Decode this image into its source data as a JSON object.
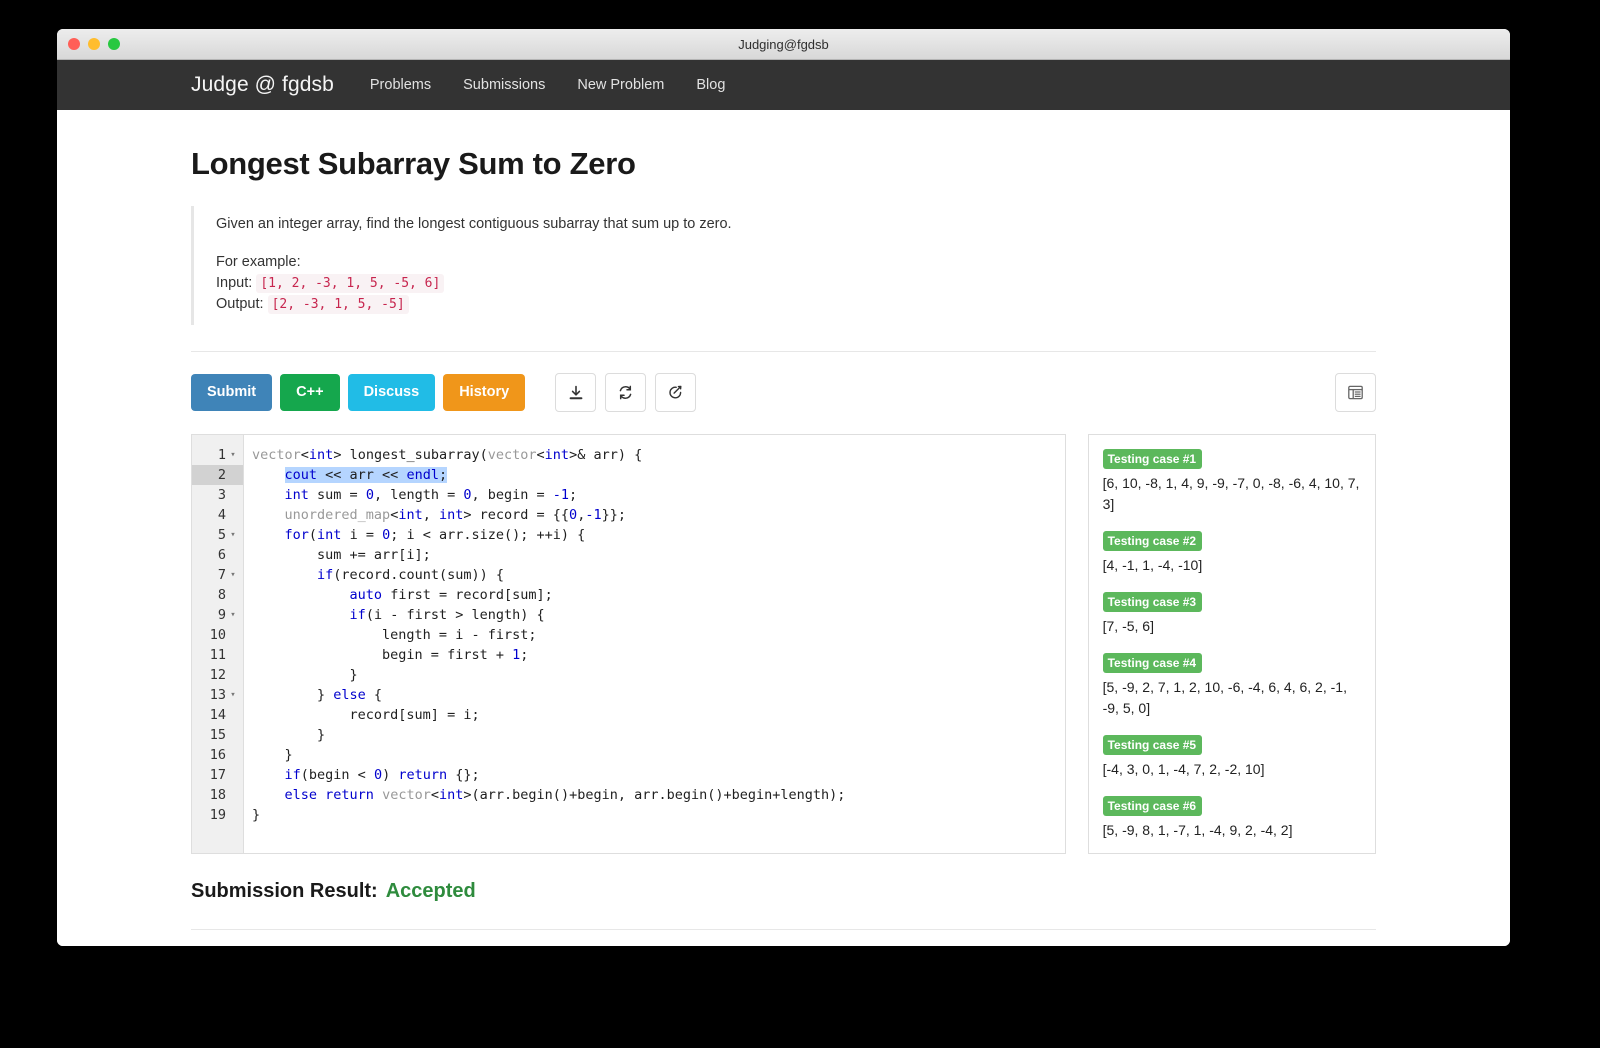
{
  "window": {
    "title": "Judging@fgdsb"
  },
  "navbar": {
    "brand": "Judge @ fgdsb",
    "links": [
      {
        "label": "Problems"
      },
      {
        "label": "Submissions"
      },
      {
        "label": "New Problem"
      },
      {
        "label": "Blog"
      }
    ]
  },
  "problem": {
    "title": "Longest Subarray Sum to Zero",
    "statement": "Given an integer array, find the longest contiguous subarray that sum up to zero.",
    "example_header": "For example:",
    "input_label": "Input:",
    "input_value": "[1, 2, -3, 1, 5, -5, 6]",
    "output_label": "Output:",
    "output_value": "[2, -3, 1, 5, -5]"
  },
  "toolbar": {
    "submit_label": "Submit",
    "language_label": "C++",
    "discuss_label": "Discuss",
    "history_label": "History",
    "download_icon": "download-icon",
    "refresh_icon": "refresh-icon",
    "edit_icon": "edit-icon",
    "list_icon": "list-icon",
    "colors": {
      "submit": "#3f84b8",
      "language": "#15a74d",
      "discuss": "#21bce6",
      "history": "#f0961a"
    }
  },
  "editor": {
    "active_line": 2,
    "lines": [
      {
        "n": "1",
        "fold": true,
        "code": "vector<int> longest_subarray(vector<int>& arr) {"
      },
      {
        "n": "2",
        "fold": false,
        "code": "    cout << arr << endl;"
      },
      {
        "n": "3",
        "fold": false,
        "code": "    int sum = 0, length = 0, begin = -1;"
      },
      {
        "n": "4",
        "fold": false,
        "code": "    unordered_map<int, int> record = {{0,-1}};"
      },
      {
        "n": "5",
        "fold": true,
        "code": "    for(int i = 0; i < arr.size(); ++i) {"
      },
      {
        "n": "6",
        "fold": false,
        "code": "        sum += arr[i];"
      },
      {
        "n": "7",
        "fold": true,
        "code": "        if(record.count(sum)) {"
      },
      {
        "n": "8",
        "fold": false,
        "code": "            auto first = record[sum];"
      },
      {
        "n": "9",
        "fold": true,
        "code": "            if(i - first > length) {"
      },
      {
        "n": "10",
        "fold": false,
        "code": "                length = i - first;"
      },
      {
        "n": "11",
        "fold": false,
        "code": "                begin = first + 1;"
      },
      {
        "n": "12",
        "fold": false,
        "code": "            }"
      },
      {
        "n": "13",
        "fold": true,
        "code": "        } else {"
      },
      {
        "n": "14",
        "fold": false,
        "code": "            record[sum] = i;"
      },
      {
        "n": "15",
        "fold": false,
        "code": "        }"
      },
      {
        "n": "16",
        "fold": false,
        "code": "    }"
      },
      {
        "n": "17",
        "fold": false,
        "code": "    if(begin < 0) return {};"
      },
      {
        "n": "18",
        "fold": false,
        "code": "    else return vector<int>(arr.begin()+begin, arr.begin()+begin+length);"
      },
      {
        "n": "19",
        "fold": false,
        "code": "}"
      }
    ]
  },
  "tests": {
    "cases": [
      {
        "label": "Testing case #1",
        "data": "[6, 10, -8, 1, 4, 9, -9, -7, 0, -8, -6, 4, 10, 7, 3]"
      },
      {
        "label": "Testing case #2",
        "data": "[4, -1, 1, -4, -10]"
      },
      {
        "label": "Testing case #3",
        "data": "[7, -5, 6]"
      },
      {
        "label": "Testing case #4",
        "data": "[5, -9, 2, 7, 1, 2, 10, -6, -4, 6, 4, 6, 2, -1, -9, 5, 0]"
      },
      {
        "label": "Testing case #5",
        "data": "[-4, 3, 0, 1, -4, 7, 2, -2, 10]"
      },
      {
        "label": "Testing case #6",
        "data": "[5, -9, 8, 1, -7, 1, -4, 9, 2, -4, 2]"
      }
    ],
    "badge_color": "#5cb85c"
  },
  "result": {
    "label": "Submission Result:",
    "status": "Accepted",
    "status_color": "#2e8b3d"
  }
}
